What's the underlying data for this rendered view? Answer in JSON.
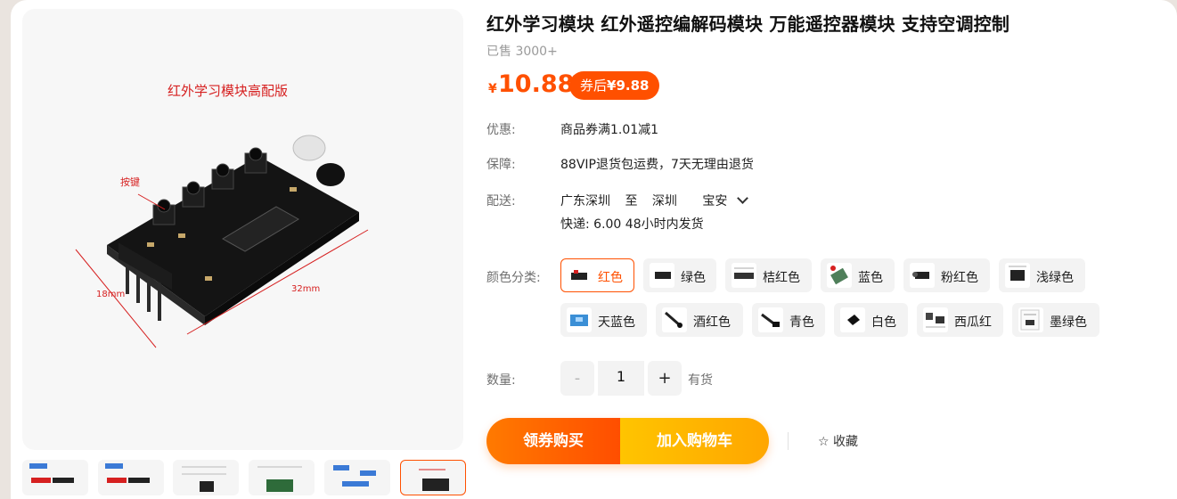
{
  "product": {
    "title": "红外学习模块 红外遥控编解码模块 万能遥控器模块 支持空调控制",
    "sold": "已售 3000+"
  },
  "main_image": {
    "caption": "红外学习模块高配版",
    "label_keys": "按键",
    "label_width": "18mm",
    "label_length": "32mm"
  },
  "price": {
    "currency": "¥",
    "value": "10.88",
    "coupon_prefix": "券后",
    "coupon_value": "¥9.88"
  },
  "rows": {
    "promo_label": "优惠:",
    "promo_value": "商品券满1.01减1",
    "guarantee_label": "保障:",
    "guarantee_value": "88VIP退货包运费，7天无理由退货",
    "ship_label": "配送:",
    "ship_from": "广东深圳",
    "ship_to_word": "至",
    "ship_city": "深圳",
    "ship_district": "宝安",
    "ship_detail": "快递: 6.00   48小时内发货"
  },
  "options": {
    "label": "颜色分类:",
    "items": [
      {
        "name": "红色",
        "selected": true
      },
      {
        "name": "绿色"
      },
      {
        "name": "桔红色"
      },
      {
        "name": "蓝色"
      },
      {
        "name": "粉红色"
      },
      {
        "name": "浅绿色"
      },
      {
        "name": "天蓝色"
      },
      {
        "name": "酒红色"
      },
      {
        "name": "青色"
      },
      {
        "name": "白色"
      },
      {
        "name": "西瓜红"
      },
      {
        "name": "墨绿色"
      }
    ]
  },
  "quantity": {
    "label": "数量:",
    "minus": "-",
    "value": "1",
    "plus": "+",
    "stock": "有货"
  },
  "actions": {
    "coupon_buy": "领券购买",
    "add_cart": "加入购物车",
    "favorite": "收藏",
    "favorite_icon": "star-outline-icon"
  },
  "colors": {
    "accent": "#ff5000",
    "cart_yellow": "#ffb300",
    "muted": "#9a9a9a"
  }
}
